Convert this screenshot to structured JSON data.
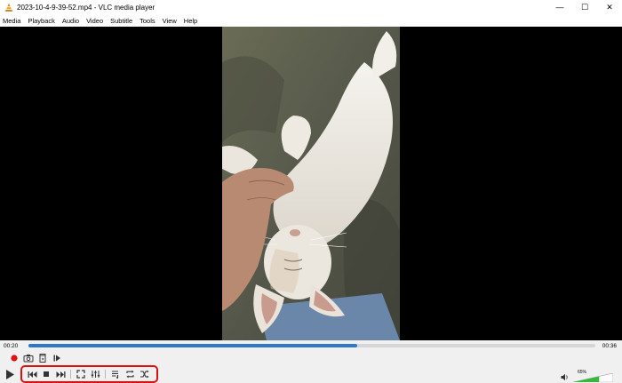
{
  "window": {
    "title": "2023-10-4-9-39-52.mp4 - VLC media player",
    "minimize_glyph": "—",
    "maximize_glyph": "☐",
    "close_glyph": "✕"
  },
  "menu": {
    "items": [
      "Media",
      "Playback",
      "Audio",
      "Video",
      "Subtitle",
      "Tools",
      "View",
      "Help"
    ]
  },
  "playback": {
    "elapsed": "00:20",
    "duration": "00:36",
    "progress_fraction": 0.58
  },
  "volume": {
    "label": "65%",
    "level_fraction": 0.65
  },
  "colors": {
    "seek_fill": "#2f78c8",
    "record": "#e01010",
    "highlight": "#e01010",
    "volume_fill": "#36b83c"
  },
  "icons": {
    "advanced": [
      "record-icon",
      "snapshot-icon",
      "loop-ab-icon",
      "frame-step-icon"
    ],
    "controls": [
      "play-icon",
      "previous-icon",
      "stop-icon",
      "next-icon",
      "fullscreen-icon",
      "extended-settings-icon",
      "playlist-icon",
      "loop-icon",
      "shuffle-icon"
    ]
  }
}
